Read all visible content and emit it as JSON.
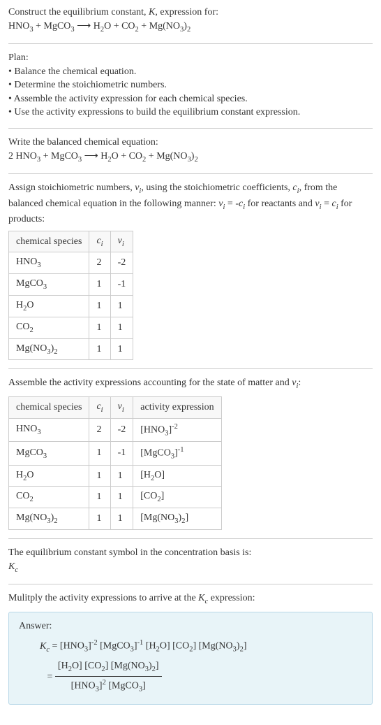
{
  "intro": {
    "line1": "Construct the equilibrium constant, K, expression for:",
    "equation": "HNO₃ + MgCO₃ ⟶ H₂O + CO₂ + Mg(NO₃)₂"
  },
  "plan": {
    "title": "Plan:",
    "items": [
      "• Balance the chemical equation.",
      "• Determine the stoichiometric numbers.",
      "• Assemble the activity expression for each chemical species.",
      "• Use the activity expressions to build the equilibrium constant expression."
    ]
  },
  "balanced": {
    "title": "Write the balanced chemical equation:",
    "equation": "2 HNO₃ + MgCO₃ ⟶ H₂O + CO₂ + Mg(NO₃)₂"
  },
  "stoich": {
    "intro": "Assign stoichiometric numbers, νᵢ, using the stoichiometric coefficients, cᵢ, from the balanced chemical equation in the following manner: νᵢ = -cᵢ for reactants and νᵢ = cᵢ for products:",
    "headers": [
      "chemical species",
      "cᵢ",
      "νᵢ"
    ],
    "rows": [
      {
        "species": "HNO₃",
        "c": "2",
        "v": "-2"
      },
      {
        "species": "MgCO₃",
        "c": "1",
        "v": "-1"
      },
      {
        "species": "H₂O",
        "c": "1",
        "v": "1"
      },
      {
        "species": "CO₂",
        "c": "1",
        "v": "1"
      },
      {
        "species": "Mg(NO₃)₂",
        "c": "1",
        "v": "1"
      }
    ]
  },
  "activity": {
    "intro": "Assemble the activity expressions accounting for the state of matter and νᵢ:",
    "headers": [
      "chemical species",
      "cᵢ",
      "νᵢ",
      "activity expression"
    ],
    "rows": [
      {
        "species": "HNO₃",
        "c": "2",
        "v": "-2",
        "expr": "[HNO₃]⁻²"
      },
      {
        "species": "MgCO₃",
        "c": "1",
        "v": "-1",
        "expr": "[MgCO₃]⁻¹"
      },
      {
        "species": "H₂O",
        "c": "1",
        "v": "1",
        "expr": "[H₂O]"
      },
      {
        "species": "CO₂",
        "c": "1",
        "v": "1",
        "expr": "[CO₂]"
      },
      {
        "species": "Mg(NO₃)₂",
        "c": "1",
        "v": "1",
        "expr": "[Mg(NO₃)₂]"
      }
    ]
  },
  "kc_symbol": {
    "line1": "The equilibrium constant symbol in the concentration basis is:",
    "line2": "K_c"
  },
  "multiply": {
    "intro": "Mulitply the activity expressions to arrive at the K_c expression:"
  },
  "answer": {
    "label": "Answer:",
    "line1_lhs": "K_c = ",
    "line1_rhs": "[HNO₃]⁻² [MgCO₃]⁻¹ [H₂O] [CO₂] [Mg(NO₃)₂]",
    "line2_eq": "= ",
    "frac_num": "[H₂O] [CO₂] [Mg(NO₃)₂]",
    "frac_den": "[HNO₃]² [MgCO₃]"
  }
}
